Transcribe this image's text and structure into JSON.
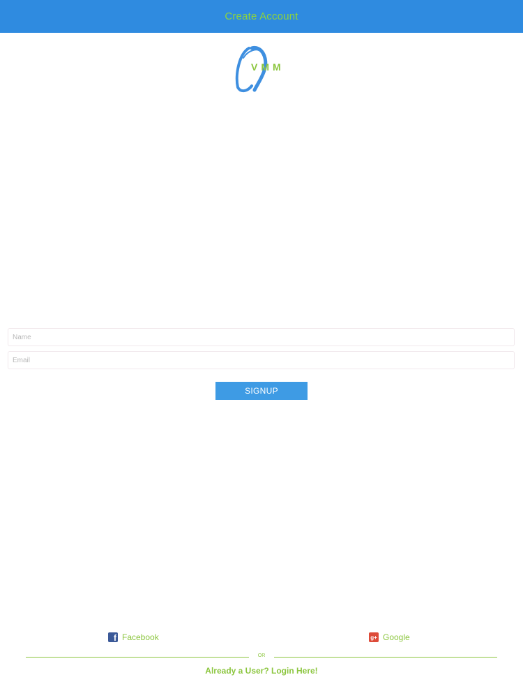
{
  "header": {
    "title": "Create Account"
  },
  "logo": {
    "text": "VMM"
  },
  "form": {
    "name": {
      "placeholder": "Name",
      "value": ""
    },
    "email": {
      "placeholder": "Email",
      "value": ""
    },
    "signup_label": "SIGNUP"
  },
  "social": {
    "facebook_label": "Facebook",
    "facebook_icon": "facebook-icon",
    "google_label": "Google",
    "google_icon": "google-plus-icon"
  },
  "divider": {
    "text": "OR"
  },
  "login": {
    "label": "Already a User? Login Here!"
  },
  "colors": {
    "header_bg": "#2f8be0",
    "accent_green": "#8cc63f",
    "button_bg": "#3e9be4"
  }
}
